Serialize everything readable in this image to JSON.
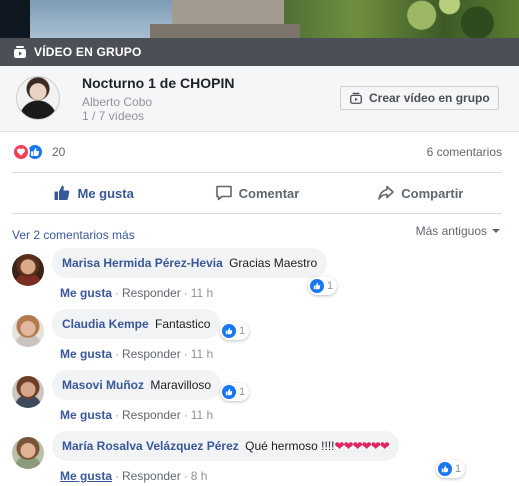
{
  "group_bar": {
    "label": "VÍDEO EN GRUPO"
  },
  "header": {
    "title": "Nocturno 1 de CHOPIN",
    "author": "Alberto Cobo",
    "video_count": "1 / 7 vídeos",
    "create_button": "Crear vídeo en grupo"
  },
  "reactions": {
    "count": "20",
    "comments": "6 comentarios"
  },
  "actions": {
    "like": "Me gusta",
    "comment": "Comentar",
    "share": "Compartir"
  },
  "comments_section": {
    "more": "Ver 2 comentarios más",
    "sort": "Más antiguos"
  },
  "comments": [
    {
      "author": "Marisa Hermida Pérez-Hevia",
      "text": "Gracias Maestro",
      "like": "Me gusta",
      "reply": "Responder",
      "time": "11 h",
      "reactions": "1"
    },
    {
      "author": "Claudia Kempe",
      "text": "Fantastico",
      "like": "Me gusta",
      "reply": "Responder",
      "time": "11 h",
      "reactions": "1"
    },
    {
      "author": "Masovi Muñoz",
      "text": "Maravilloso",
      "like": "Me gusta",
      "reply": "Responder",
      "time": "11 h",
      "reactions": "1"
    },
    {
      "author": "María Rosalva Velázquez Pérez",
      "text": "Qué hermoso !!!!",
      "emoji": "❤❤❤❤❤❤",
      "like": "Me gusta",
      "reply": "Responder",
      "time": "8 h",
      "reactions": "1"
    }
  ],
  "colors": {
    "link": "#385898",
    "group_bar": "#4b4f56",
    "like_blue": "#1877f2",
    "love_red": "#f33e58"
  }
}
